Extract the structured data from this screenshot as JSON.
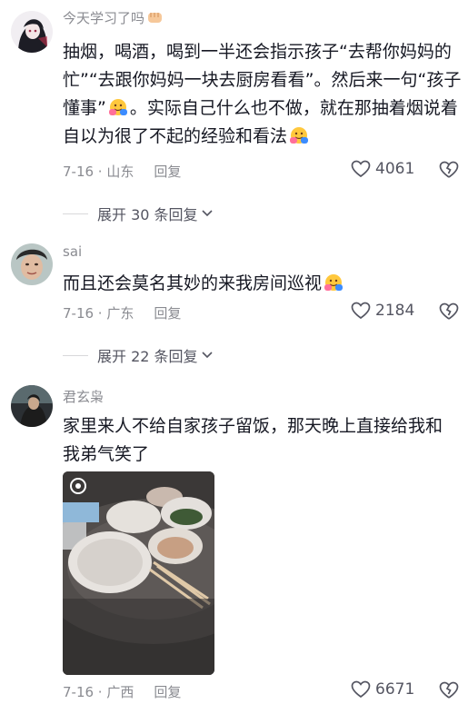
{
  "comments": [
    {
      "username": "今天学习了吗",
      "text_before_emoji1": "抽烟，喝酒，喝到一半还会指示孩子“去帮你妈妈的忙”“去跟你妈妈一块去厨房看看”。然后来一句“孩子懂事”",
      "text_between": "。实际自己什么也不做，就在那抽着烟说着自以为很了不起的经验和看法",
      "date_location": "7-16 · 山东",
      "reply_label": "回复",
      "likes": "4061"
    },
    {
      "username": "sai",
      "text": "而且还会莫名其妙的来我房间巡视",
      "date_location": "7-16 · 广东",
      "reply_label": "回复",
      "likes": "2184"
    },
    {
      "username": "君玄枭",
      "text": "家里来人不给自家孩子留饭，那天晚上直接给我和我弟气笑了",
      "date_location": "7-16 · 广西",
      "reply_label": "回复",
      "likes": "6671"
    }
  ],
  "expand_replies": [
    {
      "label": "展开 30 条回复"
    },
    {
      "label": "展开 22 条回复"
    }
  ],
  "colors": {
    "text": "#161823",
    "meta": "#8a8b91",
    "accent": "#545561"
  },
  "icons": [
    "fist-badge-icon",
    "hug-emoji-icon",
    "heart-icon",
    "broken-heart-icon",
    "chevron-down-icon"
  ]
}
